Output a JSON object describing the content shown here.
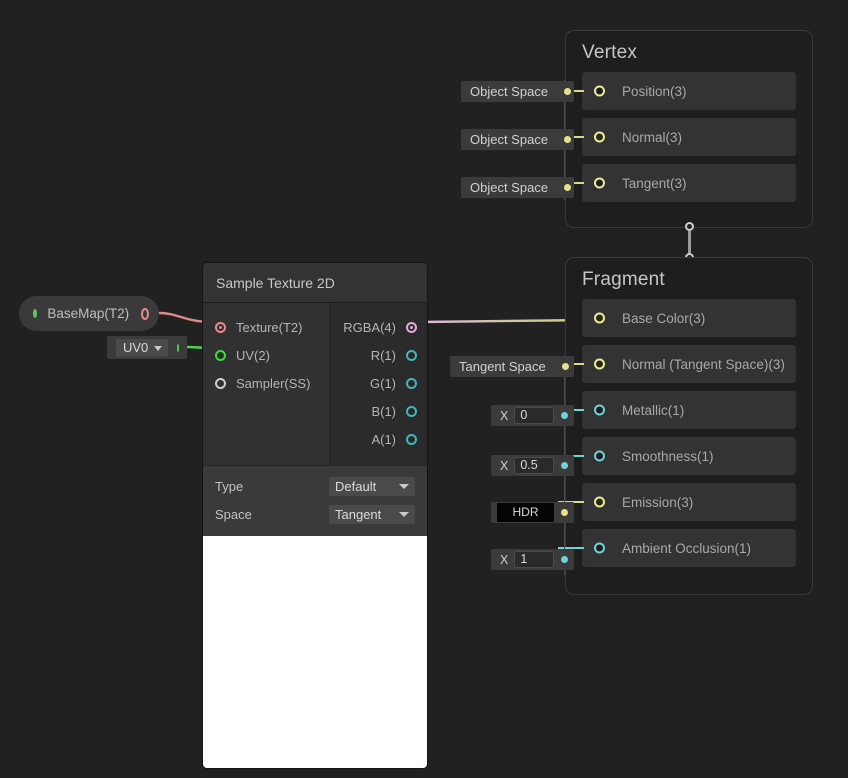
{
  "canvas": {
    "background": "#212121"
  },
  "vertex_block": {
    "title": "Vertex",
    "rows": [
      {
        "label": "Position(3)",
        "widget": "Object Space",
        "port_color": "#eceb9a",
        "filled": false
      },
      {
        "label": "Normal(3)",
        "widget": "Object Space",
        "port_color": "#eceb9a",
        "filled": true
      },
      {
        "label": "Tangent(3)",
        "widget": "Object Space",
        "port_color": "#eceb9a",
        "filled": false
      }
    ]
  },
  "fragment_block": {
    "title": "Fragment",
    "rows": [
      {
        "label": "Base Color(3)",
        "widget_type": "none",
        "widget": "",
        "port_color": "#eceb9a",
        "filled": true
      },
      {
        "label": "Normal (Tangent Space)(3)",
        "widget_type": "enum",
        "widget": "Tangent Space",
        "port_color": "#eceb9a",
        "filled": true
      },
      {
        "label": "Metallic(1)",
        "widget_type": "number",
        "widget": "0",
        "axis": "X",
        "port_color": "#6fd3d6",
        "filled": false
      },
      {
        "label": "Smoothness(1)",
        "widget_type": "number",
        "widget": "0.5",
        "axis": "X",
        "port_color": "#6fd3d6",
        "filled": false
      },
      {
        "label": "Emission(3)",
        "widget_type": "color",
        "widget": "HDR",
        "port_color": "#eceb9a",
        "filled": true
      },
      {
        "label": "Ambient Occlusion(1)",
        "widget_type": "number",
        "widget": "1",
        "axis": "X",
        "port_color": "#6fd3d6",
        "filled": false
      }
    ]
  },
  "sample_texture_node": {
    "title": "Sample Texture 2D",
    "inputs": [
      {
        "label": "Texture(T2)",
        "dot": "red",
        "connected": true
      },
      {
        "label": "UV(2)",
        "dot": "green",
        "connected": true
      },
      {
        "label": "Sampler(SS)",
        "dot": "white",
        "connected": false
      }
    ],
    "outputs": [
      {
        "label": "RGBA(4)",
        "dot": "pink",
        "connected": true
      },
      {
        "label": "R(1)",
        "dot": "teal",
        "connected": false
      },
      {
        "label": "G(1)",
        "dot": "teal",
        "connected": false
      },
      {
        "label": "B(1)",
        "dot": "teal",
        "connected": false
      },
      {
        "label": "A(1)",
        "dot": "teal",
        "connected": false
      }
    ],
    "settings": [
      {
        "label": "Type",
        "value": "Default"
      },
      {
        "label": "Space",
        "value": "Tangent"
      }
    ],
    "preview_color": "#ffffff"
  },
  "basemap_node": {
    "label": "BaseMap(T2)",
    "dot_color": "#66c266",
    "out_color": "#e58b8b"
  },
  "uv_node": {
    "value": "UV0",
    "dot_color": "#4fcf4f"
  },
  "wires": {
    "basemap_to_texture": {
      "from_color": "#d98a90",
      "to_color": "#e58b8b"
    },
    "uv_to_uvport": {
      "color": "#4fcf4f"
    },
    "rgba_to_basecolor": {
      "from_color": "#e0b5de",
      "to_color": "#d4d37e"
    }
  }
}
